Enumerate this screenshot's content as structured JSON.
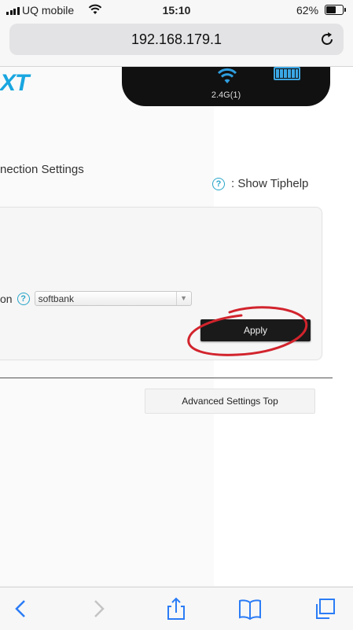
{
  "status_bar": {
    "carrier": "UQ mobile",
    "time": "15:10",
    "battery_percent": "62%",
    "battery_level": 0.62
  },
  "browser": {
    "url": "192.168.179.1"
  },
  "page": {
    "logo_text": "XT",
    "device": {
      "band_label": "2.4G(1)"
    },
    "section_title": "nection Settings",
    "tip": {
      "help_glyph": "?",
      "label": ": Show Tiphelp"
    },
    "form": {
      "field_label": "on",
      "selected_value": "softbank",
      "apply_label": "Apply"
    },
    "advanced_settings_label": "Advanced Settings Top"
  },
  "colors": {
    "logo": "#19a6e0",
    "help_icon": "#28a5c9",
    "annotation": "#d2242d"
  }
}
